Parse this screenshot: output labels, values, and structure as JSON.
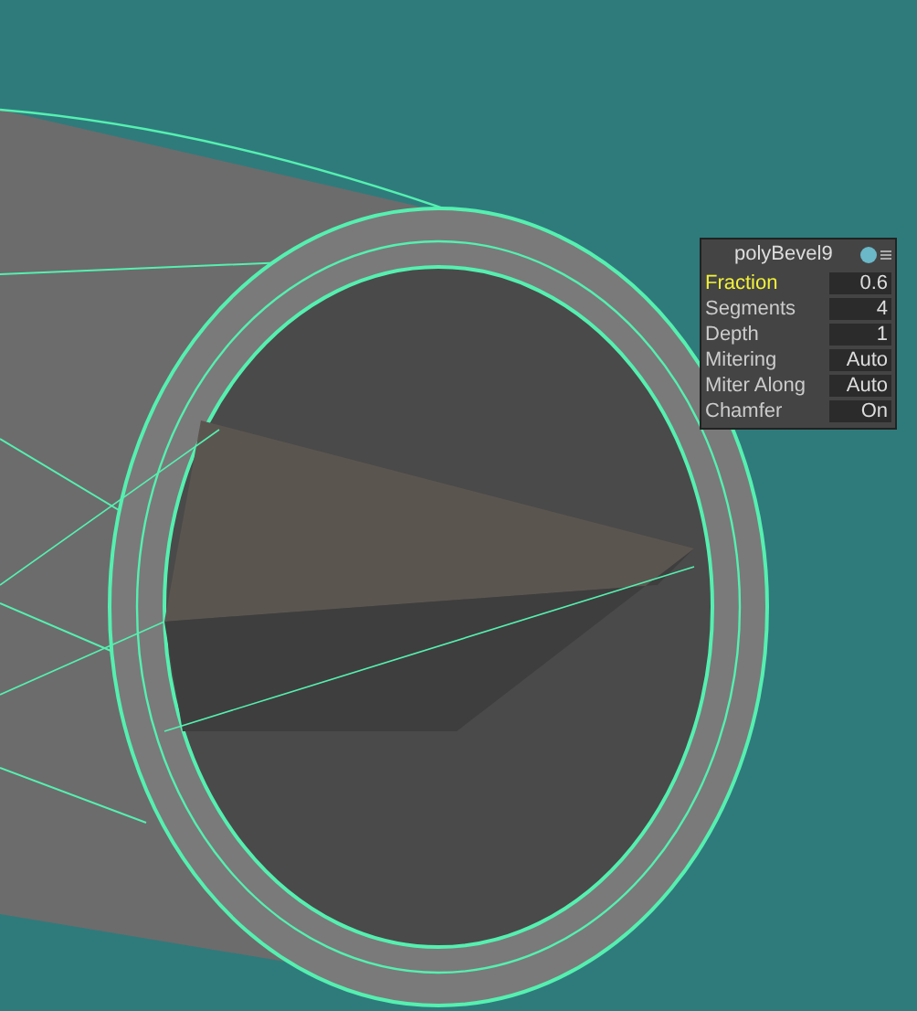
{
  "panel": {
    "title": "polyBevel9",
    "attributes": [
      {
        "label": "Fraction",
        "value": "0.6",
        "selected": true
      },
      {
        "label": "Segments",
        "value": "4",
        "selected": false
      },
      {
        "label": "Depth",
        "value": "1",
        "selected": false
      },
      {
        "label": "Mitering",
        "value": "Auto",
        "selected": false
      },
      {
        "label": "Miter Along",
        "value": "Auto",
        "selected": false
      },
      {
        "label": "Chamfer",
        "value": "On",
        "selected": false
      }
    ]
  }
}
